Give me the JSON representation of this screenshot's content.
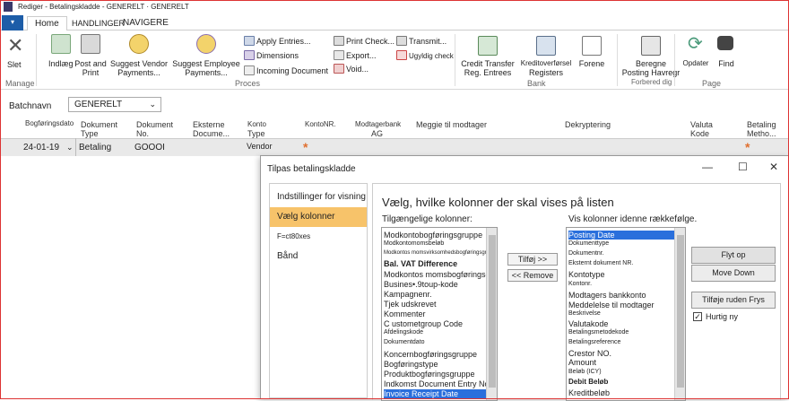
{
  "window": {
    "title": "Rediger - Betalingskladde - GENERELT · GENERELT"
  },
  "tabs": [
    "Home",
    "HANDLINGER",
    "NAVIGERE"
  ],
  "ribbon": {
    "manage": {
      "delete": "Slet",
      "group": "Manage"
    },
    "process": {
      "insert": "Indlæg",
      "post_print": [
        "Post and",
        "Print"
      ],
      "suggest_vendor": [
        "Suggest Vendor",
        "Payments..."
      ],
      "suggest_employee": [
        "Suggest Employee",
        "Payments..."
      ],
      "col1": [
        "Apply Entries...",
        "Dimensions",
        "Incoming Document"
      ],
      "col2": [
        "Print Check...",
        "Export...",
        "Void..."
      ],
      "col3": [
        "Transmit...",
        "Ugyldig check"
      ],
      "group": "Proces"
    },
    "bank": {
      "credit_transfer": [
        "Credit Transfer",
        "Reg. Entrees"
      ],
      "credit_registers": [
        "Kreditoverførsel",
        "Registers"
      ],
      "forene": "Forene",
      "group": "Bank"
    },
    "prepare": {
      "calc_posting": [
        "Beregne",
        "Posting Havregr"
      ],
      "group": "Forbered dig"
    },
    "page": {
      "refresh": "Opdater",
      "find": "Find",
      "group": "Page"
    }
  },
  "batch": {
    "label": "Batchnavn",
    "value": "GENERELT"
  },
  "grid": {
    "headers": [
      [
        "Bogføringsdato"
      ],
      [
        "Dokument",
        "Type"
      ],
      [
        "Dokument",
        "No."
      ],
      [
        "Eksterne",
        "Docume..."
      ],
      [
        "Konto",
        "Type"
      ],
      [
        "KontoNR."
      ],
      [
        "Modtagerbank",
        "AG"
      ],
      [
        "Meggie til modtager"
      ],
      [
        "Dekryptering"
      ],
      [
        "Valuta",
        "Kode"
      ],
      [
        "Betaling",
        "Metho..."
      ]
    ],
    "row": {
      "date": "24-01-19",
      "doc_type": "Betaling",
      "doc_no": "GOOOI",
      "account_type": "Vendor",
      "required_mark": "*"
    }
  },
  "dialog": {
    "title": "Tilpas betalingskladde",
    "controls": {
      "minimize": "—",
      "maximize": "☐",
      "close": "✕"
    },
    "nav": [
      "Indstillinger for visning",
      "Vælg kolonner",
      "F=ct80xes",
      "Bånd"
    ],
    "heading": "Vælg, hvilke kolonner der skal vises på listen",
    "available_label": "Tilgængelige kolonner:",
    "available": [
      "Modkontobogføringsgruppe",
      "Modkontomomsbeløb",
      "Modkontos momsvirksomhedsbogføringsgruppe",
      "Bal. VAT Difference",
      "Modkontos momsbogføringsgruppe",
      "Busines•.9toup-kode",
      "Kampagnenr.",
      "Tjek udskrevet",
      "Kommenter",
      "C ustometgroup Code",
      "Afdelingskode",
      "Dokumentdato",
      "Koncernbogføringsgruppe",
      "Bogføringstype",
      "Produktbogføringsgruppe",
      "Indkomst Document Entry No",
      "Invoice Receipt Date"
    ],
    "add_button": "Tilføj >>",
    "remove_button": "<< Remove",
    "shown_label": "Vis kolonner idenne rækkefølge.",
    "shown": [
      "Posting Date",
      "Dokumenttype",
      "Dokumentnr.",
      "Eksternt dokument NR.",
      "Kontotype",
      "Kontonr.",
      "Modtagers bankkonto",
      "Meddelelse til modtager",
      "Beskrivelse",
      "Valutakode",
      "Betalingsmetodekode",
      "Betalingsreference",
      "Crestor NO.",
      "Amount",
      "Beløb (ICY)",
      "Debit Beløb",
      "Kreditbeløb"
    ],
    "move_up": "Flyt op",
    "move_down": "Move Down",
    "add_freeze": "Tilføje ruden Frys",
    "quick_entry": {
      "label": "Hurtig ny",
      "checked": "✓"
    }
  }
}
